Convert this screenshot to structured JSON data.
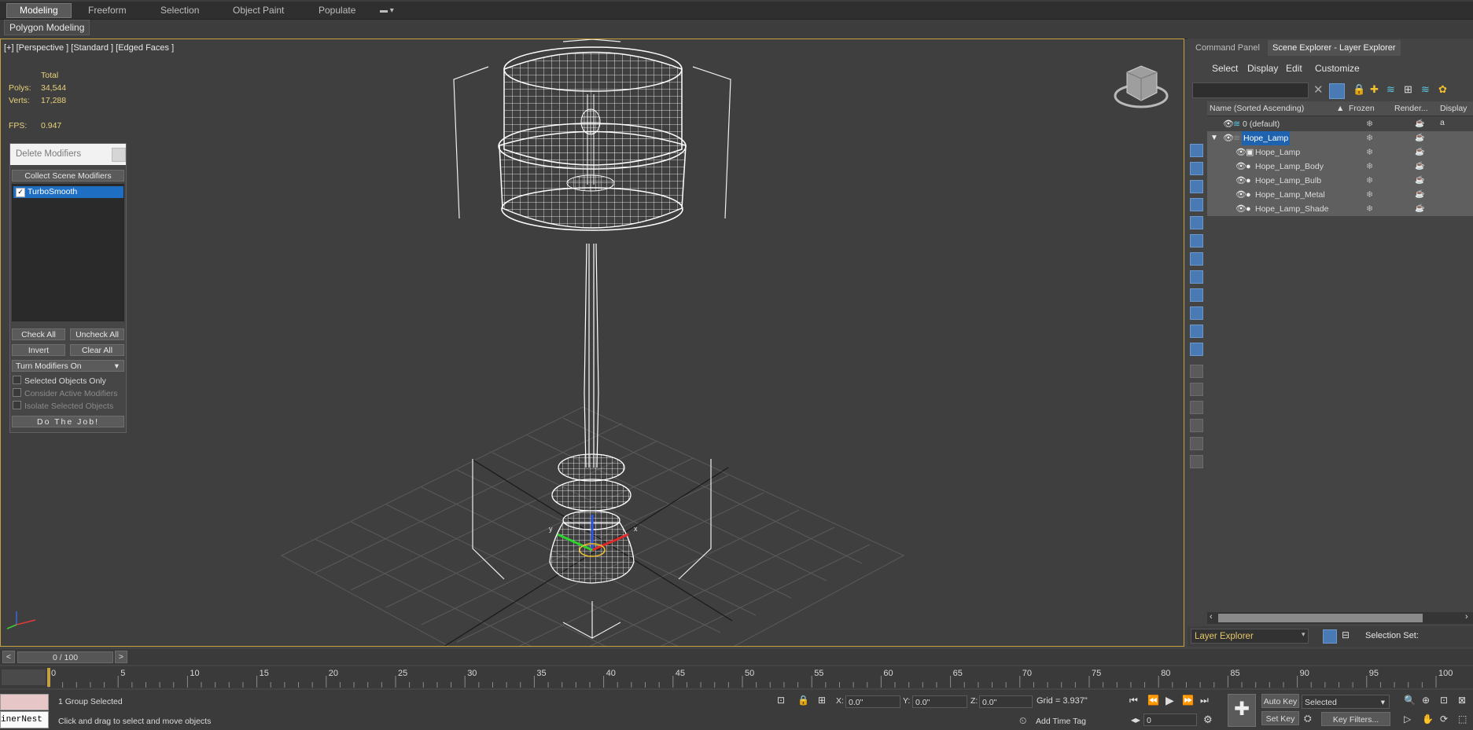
{
  "ribbon": {
    "tabs": [
      "Modeling",
      "Freeform",
      "Selection",
      "Object Paint",
      "Populate"
    ],
    "active_tab": "Modeling",
    "sub_label": "Polygon Modeling"
  },
  "viewport": {
    "label": "[+] [Perspective ] [Standard ] [Edged Faces ]",
    "stats": {
      "total_label": "Total",
      "polys_label": "Polys:",
      "polys_value": "34,544",
      "verts_label": "Verts:",
      "verts_value": "17,288",
      "fps_label": "FPS:",
      "fps_value": "0.947"
    }
  },
  "delete_modifiers": {
    "title": "Delete Modifiers",
    "collect_label": "Collect Scene Modifiers",
    "list_items": [
      {
        "label": "TurboSmooth",
        "checked": true
      }
    ],
    "check_all": "Check All",
    "uncheck_all": "Uncheck All",
    "invert": "Invert",
    "clear_all": "Clear All",
    "mode_value": "Turn Modifiers On",
    "opt_selected_only": "Selected Objects Only",
    "opt_consider_active": "Consider Active Modifiers",
    "opt_isolate": "Isolate Selected Objects",
    "do_job": "Do The Job!"
  },
  "right_panel": {
    "tabs": [
      "Command Panel",
      "Scene Explorer - Layer Explorer"
    ],
    "menus": [
      "Select",
      "Display",
      "Edit",
      "Customize"
    ],
    "columns": {
      "name": "Name (Sorted Ascending)",
      "frozen": "Frozen",
      "render": "Render...",
      "display": "Display a"
    },
    "rows": [
      {
        "name": "0 (default)",
        "indent": 0
      },
      {
        "name": "Hope_Lamp",
        "indent": 0
      },
      {
        "name": "Hope_Lamp",
        "indent": 1
      },
      {
        "name": "Hope_Lamp_Body",
        "indent": 1
      },
      {
        "name": "Hope_Lamp_Bulb",
        "indent": 1
      },
      {
        "name": "Hope_Lamp_Metal",
        "indent": 1
      },
      {
        "name": "Hope_Lamp_Shade",
        "indent": 1
      }
    ],
    "bottom_dropdown": "Layer Explorer",
    "selection_set_label": "Selection Set:"
  },
  "timeline": {
    "slider_text": "0 / 100",
    "ticks": [
      0,
      5,
      10,
      15,
      20,
      25,
      30,
      35,
      40,
      45,
      50,
      55,
      60,
      65,
      70,
      75,
      80,
      85,
      90,
      95,
      100
    ]
  },
  "status": {
    "maxscript_text": "inerNest",
    "selection_info": "1 Group Selected",
    "prompt": "Click and drag to select and move objects",
    "x_label": "X:",
    "x_value": "0.0\"",
    "y_label": "Y:",
    "y_value": "0.0\"",
    "z_label": "Z:",
    "z_value": "0.0\"",
    "grid": "Grid = 3.937\"",
    "add_time_tag": "Add Time Tag",
    "auto_key": "Auto Key",
    "set_key": "Set Key",
    "selected_dd": "Selected",
    "key_filters": "Key Filters...",
    "frame_value": "0"
  }
}
